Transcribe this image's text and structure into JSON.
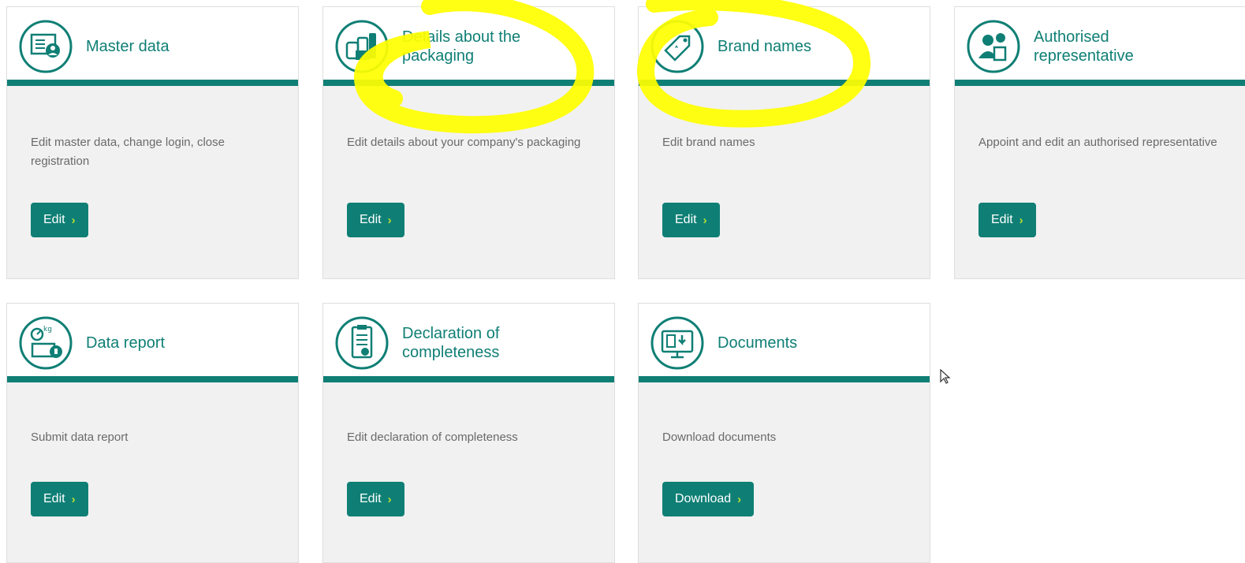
{
  "colors": {
    "accent": "#0f7f75",
    "chevron": "#b8e02e",
    "highlight": "#ffff00",
    "card_bg": "#f1f1f1"
  },
  "cards": [
    {
      "title": "Master data",
      "description": "Edit master data, change login, close registration",
      "button": "Edit",
      "icon": "master-data-icon"
    },
    {
      "title": "Details about the\npackaging",
      "description": "Edit details about your company's packaging",
      "button": "Edit",
      "icon": "packaging-icon"
    },
    {
      "title": "Brand names",
      "description": "Edit brand names",
      "button": "Edit",
      "icon": "brand-tag-icon"
    },
    {
      "title": "Authorised\nrepresentative",
      "description": "Appoint and edit an authorised representative",
      "button": "Edit",
      "icon": "representative-icon"
    },
    {
      "title": "Data report",
      "description": "Submit data report",
      "button": "Edit",
      "icon": "data-report-icon"
    },
    {
      "title": "Declaration of\ncompleteness",
      "description": "Edit declaration of completeness",
      "button": "Edit",
      "icon": "declaration-icon"
    },
    {
      "title": "Documents",
      "description": "Download documents",
      "button": "Download",
      "icon": "documents-icon"
    }
  ],
  "chevron": "›"
}
